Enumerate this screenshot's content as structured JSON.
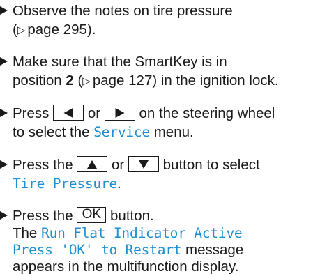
{
  "steps": [
    {
      "line1": "Observe the notes on tire pressure",
      "ref_open": "(",
      "ref_arrow": "▷",
      "ref_page": "page 295",
      "ref_close": ")."
    },
    {
      "line1": "Make sure that the SmartKey is in",
      "line2_a": "position ",
      "line2_bold": "2",
      "line2_b": " (",
      "ref_arrow": "▷",
      "ref_page": "page 127",
      "line2_c": ") in the ignition lock."
    },
    {
      "line1_a": "Press",
      "line1_or": "or",
      "line1_b": "on the steering wheel",
      "line2_a": "to select the ",
      "line2_menu": "Service",
      "line2_b": " menu."
    },
    {
      "line1_a": "Press the",
      "line1_or": "or",
      "line1_b": "button to select",
      "line2_menu": "Tire Pressure",
      "line2_b": "."
    },
    {
      "line1_a": "Press the",
      "ok_label": "OK",
      "line1_b": "button.",
      "line2_a": "The ",
      "line2_msg": "Run Flat Indicator Active",
      "line3_msg": "Press 'OK' to Restart",
      "line3_b": " message",
      "line4": "appears in the multifunction display."
    }
  ],
  "icons": {
    "bullet": "right-triangle-bullet-icon",
    "left_key": "left-arrow-key-icon",
    "right_key": "right-arrow-key-icon",
    "up_key": "up-arrow-key-icon",
    "down_key": "down-arrow-key-icon"
  },
  "colors": {
    "text": "#1a1a1a",
    "display_text": "#1f8fd1",
    "background": "#ffffff"
  }
}
